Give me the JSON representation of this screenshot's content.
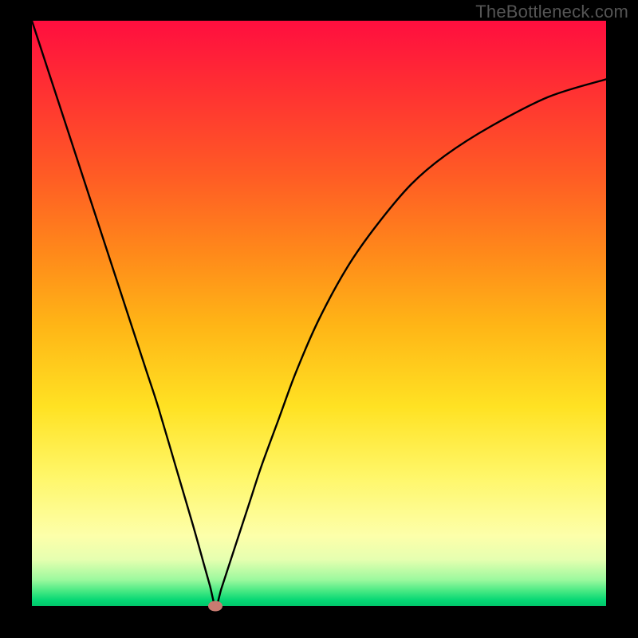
{
  "watermark": "TheBottleneck.com",
  "chart_data": {
    "type": "line",
    "title": "",
    "xlabel": "",
    "ylabel": "",
    "xlim": [
      0,
      100
    ],
    "ylim": [
      0,
      100
    ],
    "grid": false,
    "series": [
      {
        "name": "bottleneck-curve",
        "x": [
          0,
          5,
          10,
          13,
          15,
          18,
          20,
          22,
          25,
          28,
          30,
          31,
          32,
          33,
          34,
          36,
          38,
          40,
          43,
          46,
          50,
          55,
          60,
          66,
          72,
          80,
          90,
          100
        ],
        "values": [
          100,
          85,
          70,
          61,
          55,
          46,
          40,
          34,
          24,
          14,
          7,
          3.5,
          0,
          3,
          6,
          12,
          18,
          24,
          32,
          40,
          49,
          58,
          65,
          72,
          77,
          82,
          87,
          90
        ]
      }
    ],
    "annotations": [
      {
        "name": "min-point-marker",
        "x": 32,
        "y": 0
      }
    ],
    "background_gradient": {
      "top": "#ff0e3f",
      "mid": "#ffe223",
      "bottom": "#00c66a"
    }
  }
}
